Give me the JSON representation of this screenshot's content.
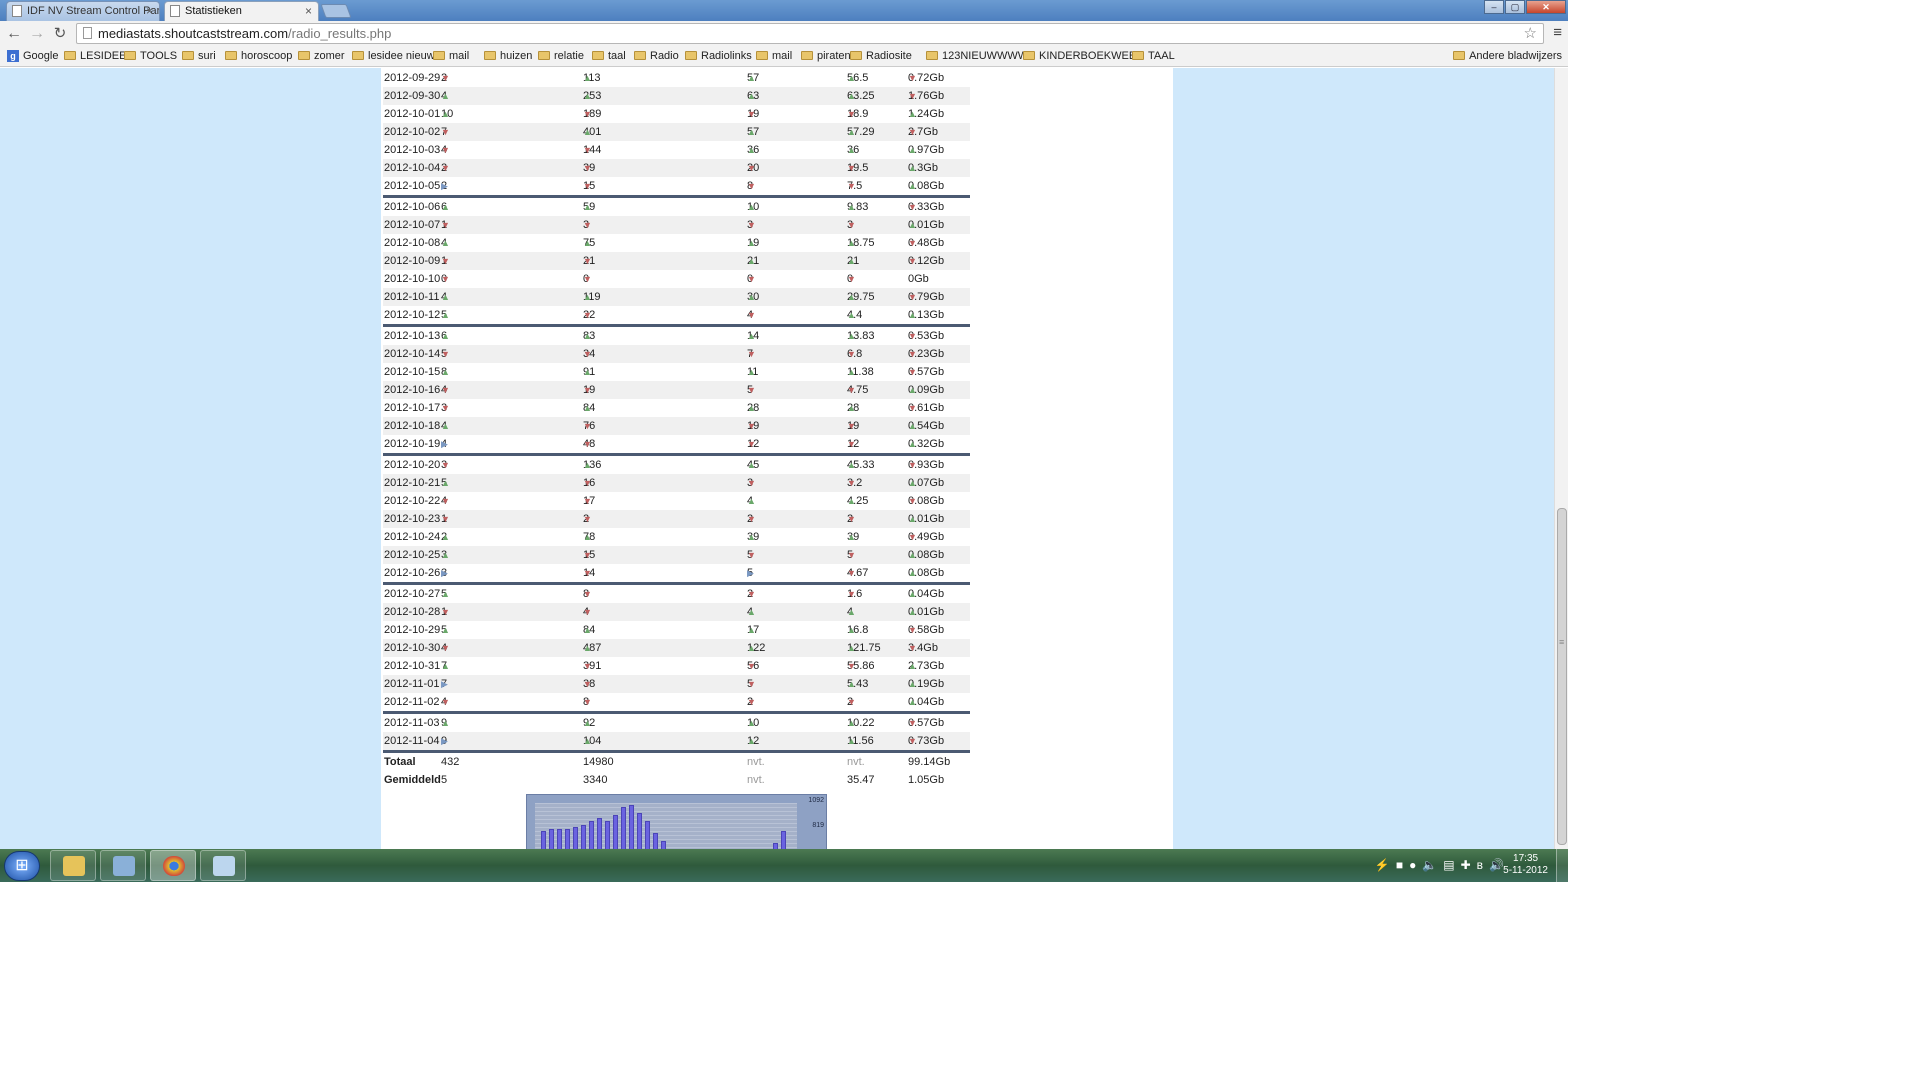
{
  "browser": {
    "tabs": [
      {
        "label": "IDF NV Stream Control Par"
      },
      {
        "label": "Statistieken"
      }
    ],
    "url_host": "mediastats.shoutcaststream.com",
    "url_path": "/radio_results.php"
  },
  "bookmarks": {
    "items": [
      "Google",
      "LESIDEE",
      "TOOLS",
      "suri",
      "horoscoop",
      "zomer",
      "lesidee nieuw",
      "mail",
      "huizen",
      "relatie",
      "taal",
      "Radio",
      "Radiolinks",
      "mail",
      "piraten",
      "Radiosite",
      "123NIEUWWWW",
      "KINDERBOEKWEEK",
      "TAAL"
    ],
    "other": "Andere bladwijzers"
  },
  "weeks": [
    [
      [
        "2012-09-29",
        "d",
        "2",
        "u",
        "113",
        "u",
        "57",
        "u",
        "56.5",
        "d",
        "0.72Gb"
      ],
      [
        "2012-09-30",
        "u",
        "4",
        "u",
        "253",
        "u",
        "63",
        "u",
        "63.25",
        "d",
        "1.76Gb"
      ],
      [
        "2012-10-01",
        "u",
        "10",
        "d",
        "189",
        "d",
        "19",
        "d",
        "18.9",
        "u",
        "1.24Gb"
      ],
      [
        "2012-10-02",
        "d",
        "7",
        "u",
        "401",
        "u",
        "57",
        "u",
        "57.29",
        "d",
        "2.7Gb"
      ],
      [
        "2012-10-03",
        "d",
        "4",
        "d",
        "144",
        "u",
        "36",
        "u",
        "36",
        "u",
        "0.97Gb"
      ],
      [
        "2012-10-04",
        "d",
        "2",
        "d",
        "39",
        "d",
        "20",
        "d",
        "19.5",
        "u",
        "0.3Gb"
      ],
      [
        "2012-10-05",
        "n",
        "2",
        "d",
        "15",
        "d",
        "8",
        "d",
        "7.5",
        "u",
        "0.08Gb"
      ]
    ],
    [
      [
        "2012-10-06",
        "u",
        "6",
        "u",
        "59",
        "u",
        "10",
        "u",
        "9.83",
        "d",
        "0.33Gb"
      ],
      [
        "2012-10-07",
        "d",
        "1",
        "d",
        "3",
        "d",
        "3",
        "d",
        "3",
        "u",
        "0.01Gb"
      ],
      [
        "2012-10-08",
        "u",
        "4",
        "u",
        "75",
        "u",
        "19",
        "u",
        "18.75",
        "d",
        "0.48Gb"
      ],
      [
        "2012-10-09",
        "d",
        "1",
        "d",
        "21",
        "u",
        "21",
        "u",
        "21",
        "d",
        "0.12Gb"
      ],
      [
        "2012-10-10",
        "d",
        "0",
        "d",
        "0",
        "d",
        "0",
        "d",
        "0",
        "",
        "0Gb"
      ],
      [
        "2012-10-11",
        "u",
        "4",
        "u",
        "119",
        "u",
        "30",
        "u",
        "29.75",
        "d",
        "0.79Gb"
      ],
      [
        "2012-10-12",
        "u",
        "5",
        "d",
        "22",
        "d",
        "4",
        "u",
        "4.4",
        "u",
        "0.13Gb"
      ]
    ],
    [
      [
        "2012-10-13",
        "u",
        "6",
        "u",
        "83",
        "u",
        "14",
        "u",
        "13.83",
        "d",
        "0.53Gb"
      ],
      [
        "2012-10-14",
        "d",
        "5",
        "d",
        "34",
        "d",
        "7",
        "d",
        "6.8",
        "d",
        "0.23Gb"
      ],
      [
        "2012-10-15",
        "u",
        "8",
        "u",
        "91",
        "u",
        "11",
        "u",
        "11.38",
        "d",
        "0.57Gb"
      ],
      [
        "2012-10-16",
        "d",
        "4",
        "d",
        "19",
        "d",
        "5",
        "d",
        "4.75",
        "u",
        "0.09Gb"
      ],
      [
        "2012-10-17",
        "d",
        "3",
        "u",
        "84",
        "u",
        "28",
        "u",
        "28",
        "d",
        "0.61Gb"
      ],
      [
        "2012-10-18",
        "u",
        "4",
        "d",
        "76",
        "d",
        "19",
        "d",
        "19",
        "u",
        "0.54Gb"
      ],
      [
        "2012-10-19",
        "n",
        "4",
        "d",
        "48",
        "d",
        "12",
        "d",
        "12",
        "u",
        "0.32Gb"
      ]
    ],
    [
      [
        "2012-10-20",
        "d",
        "3",
        "u",
        "136",
        "u",
        "45",
        "u",
        "45.33",
        "d",
        "0.93Gb"
      ],
      [
        "2012-10-21",
        "u",
        "5",
        "d",
        "16",
        "d",
        "3",
        "d",
        "3.2",
        "u",
        "0.07Gb"
      ],
      [
        "2012-10-22",
        "d",
        "4",
        "d",
        "17",
        "u",
        "4",
        "u",
        "4.25",
        "d",
        "0.08Gb"
      ],
      [
        "2012-10-23",
        "d",
        "1",
        "d",
        "2",
        "d",
        "2",
        "d",
        "2",
        "u",
        "0.01Gb"
      ],
      [
        "2012-10-24",
        "u",
        "2",
        "u",
        "78",
        "u",
        "39",
        "u",
        "39",
        "d",
        "0.49Gb"
      ],
      [
        "2012-10-25",
        "u",
        "3",
        "d",
        "15",
        "d",
        "5",
        "d",
        "5",
        "u",
        "0.08Gb"
      ],
      [
        "2012-10-26",
        "n",
        "3",
        "d",
        "14",
        "n",
        "5",
        "d",
        "4.67",
        "u",
        "0.08Gb"
      ]
    ],
    [
      [
        "2012-10-27",
        "u",
        "5",
        "d",
        "8",
        "d",
        "2",
        "d",
        "1.6",
        "u",
        "0.04Gb"
      ],
      [
        "2012-10-28",
        "d",
        "1",
        "d",
        "4",
        "u",
        "4",
        "u",
        "4",
        "u",
        "0.01Gb"
      ],
      [
        "2012-10-29",
        "u",
        "5",
        "u",
        "84",
        "u",
        "17",
        "u",
        "16.8",
        "d",
        "0.58Gb"
      ],
      [
        "2012-10-30",
        "d",
        "4",
        "u",
        "487",
        "u",
        "122",
        "u",
        "121.75",
        "d",
        "3.4Gb"
      ],
      [
        "2012-10-31",
        "u",
        "7",
        "d",
        "391",
        "d",
        "56",
        "d",
        "55.86",
        "u",
        "2.73Gb"
      ],
      [
        "2012-11-01",
        "n",
        "7",
        "d",
        "38",
        "d",
        "5",
        "u",
        "5.43",
        "u",
        "0.19Gb"
      ],
      [
        "2012-11-02",
        "d",
        "4",
        "d",
        "8",
        "d",
        "2",
        "d",
        "2",
        "u",
        "0.04Gb"
      ]
    ],
    [
      [
        "2012-11-03",
        "u",
        "9",
        "u",
        "92",
        "u",
        "10",
        "u",
        "10.22",
        "d",
        "0.57Gb"
      ],
      [
        "2012-11-04",
        "n",
        "9",
        "u",
        "104",
        "u",
        "12",
        "u",
        "11.56",
        "d",
        "0.73Gb"
      ]
    ]
  ],
  "totals": {
    "label": "Totaal",
    "listeners": "432",
    "sessions": "14980",
    "peak": "nvt.",
    "avg": "nvt.",
    "traffic": "99.14Gb"
  },
  "average": {
    "label": "Gemiddeld",
    "listeners": "5",
    "sessions": "3340",
    "peak": "nvt.",
    "avg": "35.47",
    "traffic": "1.05Gb"
  },
  "mini_chart": {
    "y_labels": [
      "1092",
      "819"
    ],
    "colors": {
      "bar": "#6a63e0",
      "panel": "#8ea1c4"
    }
  },
  "clock": {
    "time": "17:35",
    "date": "5-11-2012"
  }
}
